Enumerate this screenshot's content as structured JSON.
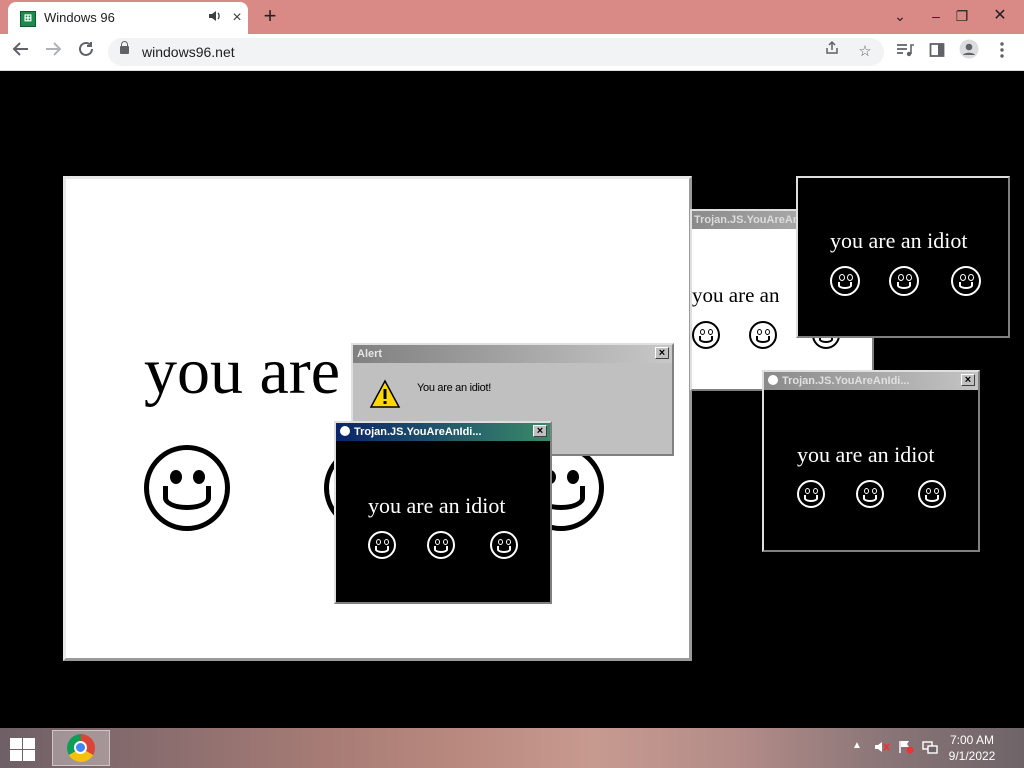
{
  "browser": {
    "tab": {
      "title": "Windows 96",
      "favicon": "windows96-favicon"
    },
    "address": {
      "url": "windows96.net"
    },
    "icons": {
      "back": "back-arrow-icon",
      "forward": "forward-arrow-icon",
      "reload": "reload-icon",
      "share": "share-icon",
      "bookmark": "star-icon",
      "media": "media-control-icon",
      "sidepanel": "side-panel-icon",
      "profile": "profile-icon",
      "menu": "kebab-menu-icon"
    }
  },
  "page": {
    "main_window": {
      "text": "you are an idiot"
    },
    "window_right_back": {
      "title": "Trojan.JS.YouAreAnIdi",
      "text": "you are an"
    },
    "window_top_right": {
      "text": "you are an idiot"
    },
    "window_mid_right": {
      "title": "Trojan.JS.YouAreAnIdi...",
      "text": "you are an idiot"
    },
    "alert": {
      "title": "Alert",
      "message": "You are an idiot!"
    },
    "window_front": {
      "title": "Trojan.JS.YouAreAnIdi...",
      "text": "you are an idiot"
    }
  },
  "taskbar": {
    "clock": {
      "time": "7:00 AM",
      "date": "9/1/2022"
    },
    "start_icon": "windows-start-icon",
    "pinned": [
      "chrome-icon"
    ]
  },
  "colors": {
    "titlebar_chrome": "#d98a86",
    "win98_gray": "#c0c0c0",
    "active_title_start": "#0a246a",
    "active_title_end": "#3a8a6a"
  }
}
